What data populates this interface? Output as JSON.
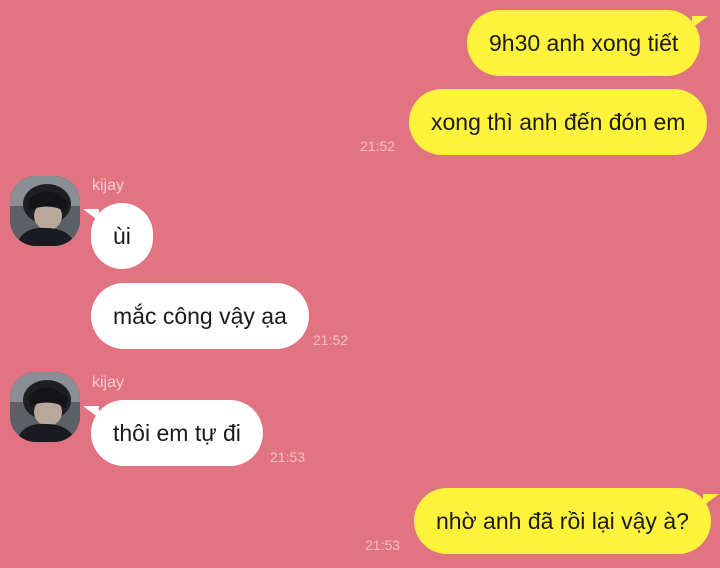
{
  "colors": {
    "background": "#e27482",
    "outgoing_bubble": "#fff33b",
    "incoming_bubble": "#ffffff",
    "timestamp": "#f3c0c6",
    "sender_name": "#f6cdd2"
  },
  "messages": [
    {
      "direction": "outgoing",
      "text": "9h30 anh xong tiết"
    },
    {
      "direction": "outgoing",
      "text": "xong thì anh đến đón em",
      "time": "21:52"
    },
    {
      "direction": "incoming",
      "sender": "kijay",
      "avatar_icon": "profile-photo",
      "text": "ùi"
    },
    {
      "direction": "incoming",
      "text": "mắc công vậy ạa",
      "time": "21:52"
    },
    {
      "direction": "incoming",
      "sender": "kijay",
      "avatar_icon": "profile-photo",
      "text": "thôi em tự đi",
      "time": "21:53"
    },
    {
      "direction": "outgoing",
      "text": "nhờ anh đã rồi lại vậy à?",
      "time": "21:53"
    }
  ]
}
